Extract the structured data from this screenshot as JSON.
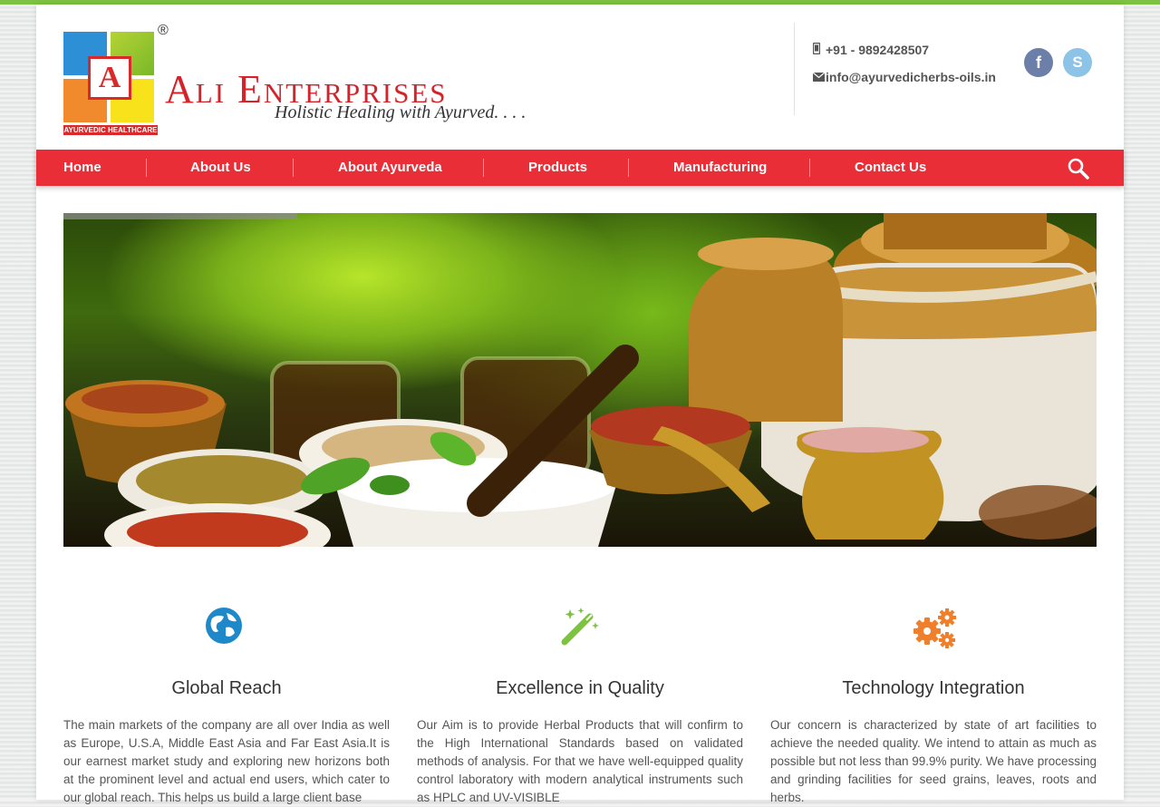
{
  "brand": {
    "name": "Ali Enterprises",
    "tagline": "Holistic Healing with Ayurved. . . .",
    "logo_letter": "A",
    "logo_caption": "AYURVEDIC HEALTHCARE",
    "registered_mark": "®"
  },
  "contact": {
    "phone": "+91 - 9892428507",
    "email": "info@ayurvedicherbs-oils.in",
    "phone_icon": "mobile-phone-icon",
    "email_icon": "envelope-icon"
  },
  "social": {
    "facebook_glyph": "f",
    "skype_glyph": "S"
  },
  "nav": {
    "items": [
      {
        "label": "Home"
      },
      {
        "label": "About Us"
      },
      {
        "label": "About Ayurveda"
      },
      {
        "label": "Products"
      },
      {
        "label": "Manufacturing"
      },
      {
        "label": "Contact Us"
      }
    ],
    "search_icon": "search-icon"
  },
  "features": [
    {
      "icon": "globe-icon",
      "title": "Global Reach",
      "text": "The main markets of the company are all over India as well as Europe, U.S.A, Middle East Asia and Far East Asia.It is our earnest market study and exploring new horizons both at the prominent level and actual end users, which cater to our global reach. This helps us build a large client base"
    },
    {
      "icon": "magic-wand-icon",
      "title": "Excellence in Quality",
      "text": "Our Aim is to provide Herbal Products that will confirm to the High International Standards based on validated methods of analysis. For that we have well-equipped quality control laboratory with modern analytical instruments such as HPLC and UV-VISIBLE"
    },
    {
      "icon": "gears-icon",
      "title": "Technology Integration",
      "text": "Our concern is characterized by state of art facilities to achieve the needed quality. We intend to attain as much as possible but not less than 99.9% purity. We have processing and grinding facilities for seed grains, leaves, roots and herbs."
    }
  ],
  "colors": {
    "accent_green": "#7dc242",
    "nav_red": "#ea2e37",
    "brand_red": "#d6232a",
    "globe_blue": "#1e88c9",
    "wand_green": "#7dc242",
    "gears_orange": "#f07f2c"
  }
}
